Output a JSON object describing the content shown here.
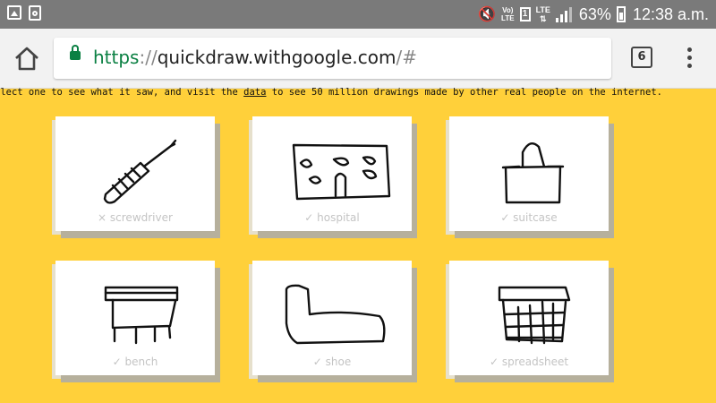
{
  "status_bar": {
    "volte_label": "Vo)\nLTE",
    "sim_label": "1",
    "lte_label": "LTE\n⇅",
    "battery_percent": "63%",
    "time": "12:38 a.m."
  },
  "browser": {
    "url_scheme": "https",
    "url_separator": "://",
    "url_host": "quickdraw.withgoogle.com",
    "url_path": "/#",
    "tab_count": "6"
  },
  "page": {
    "intro_before": "elect one to see what it saw, and visit the ",
    "intro_link": "data",
    "intro_after": " to see 50 million drawings made by other real people on the internet."
  },
  "cards": [
    {
      "label": "× screwdriver"
    },
    {
      "label": "✓ hospital"
    },
    {
      "label": "✓ suitcase"
    },
    {
      "label": "✓ bench"
    },
    {
      "label": "✓ shoe"
    },
    {
      "label": "✓ spreadsheet"
    }
  ],
  "colors": {
    "page_background": "#ffd03a",
    "secure_green": "#0b8043"
  }
}
